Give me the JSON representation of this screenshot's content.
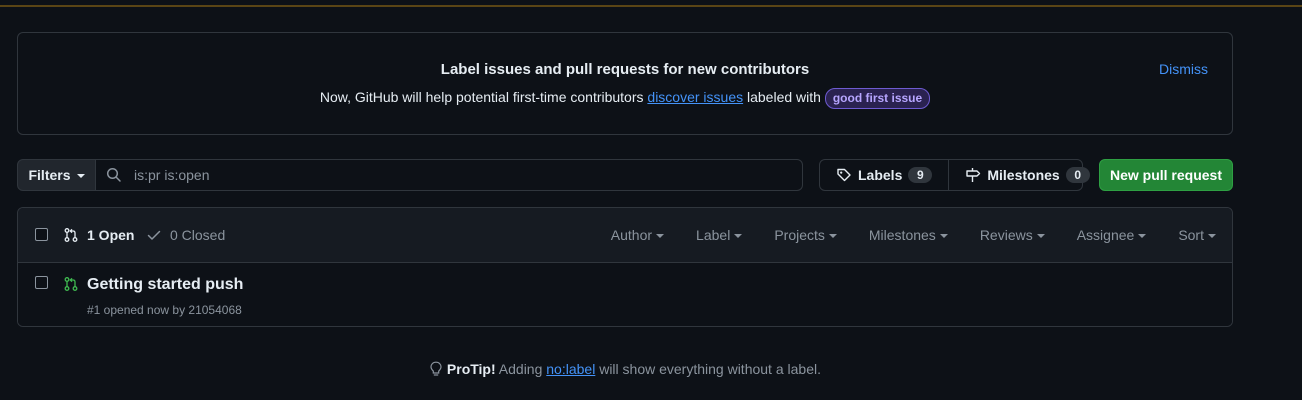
{
  "banner": {
    "title": "Label issues and pull requests for new contributors",
    "body_prefix": "Now, GitHub will help potential first-time contributors",
    "body_link": "discover issues",
    "body_suffix": "labeled with",
    "label_chip": "good first issue",
    "dismiss": "Dismiss"
  },
  "filters": {
    "button_label": "Filters",
    "search_value": "is:pr is:open"
  },
  "labels_button": {
    "label": "Labels",
    "count": "9"
  },
  "milestones_button": {
    "label": "Milestones",
    "count": "0"
  },
  "new_pr_button": "New pull request",
  "list_header": {
    "open_label": "1 Open",
    "closed_label": "0 Closed",
    "sorts": [
      "Author",
      "Label",
      "Projects",
      "Milestones",
      "Reviews",
      "Assignee",
      "Sort"
    ]
  },
  "pull_requests": [
    {
      "title": "Getting started push",
      "meta": "#1 opened now by 21054068"
    }
  ],
  "protip": {
    "lead": "ProTip!",
    "prefix": "Adding",
    "link": "no:label",
    "suffix": "will show everything without a label."
  },
  "colors": {
    "accent_link": "#4493f8",
    "primary_button": "#238636",
    "open_icon": "#3fb950"
  }
}
